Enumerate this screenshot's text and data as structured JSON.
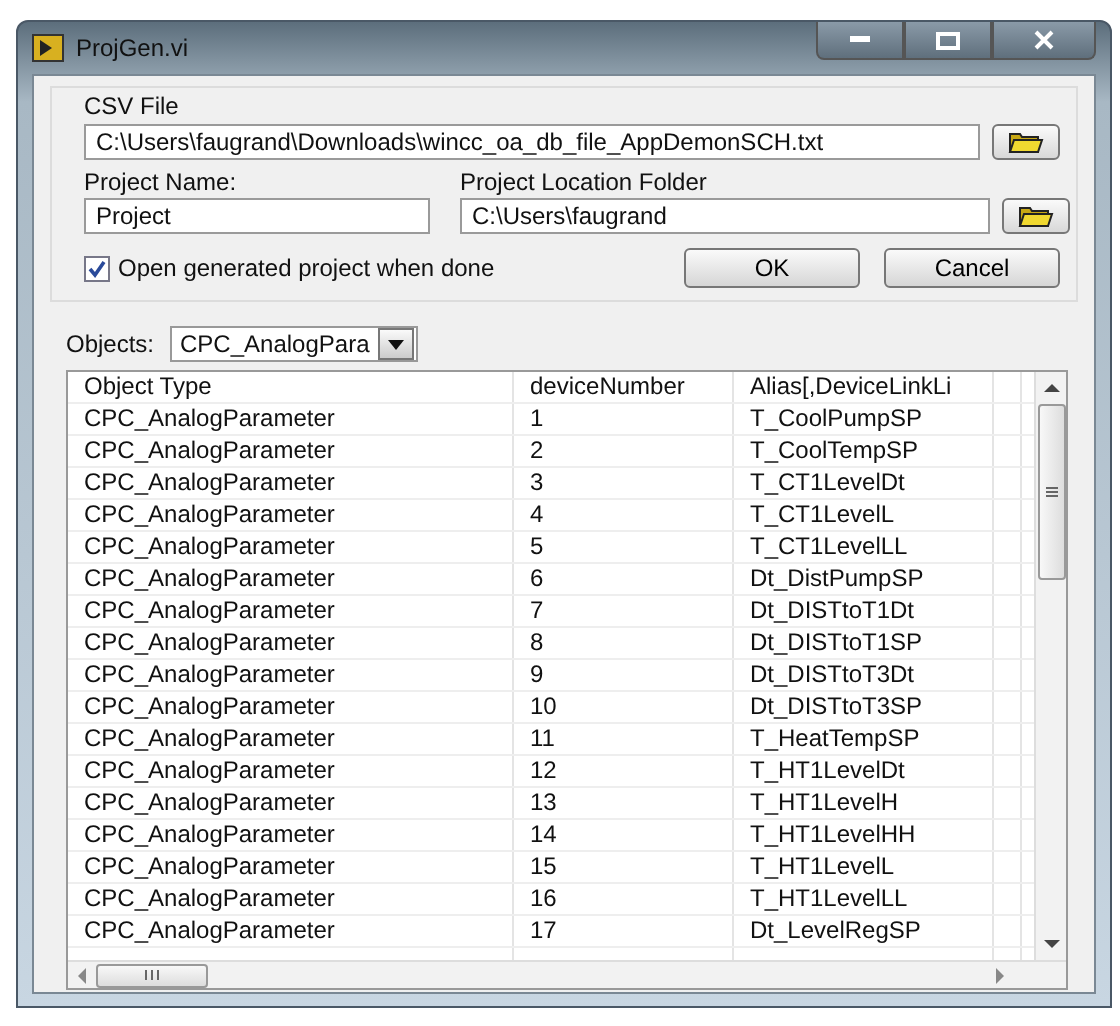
{
  "window": {
    "title": "ProjGen.vi"
  },
  "csv_file": {
    "label": "CSV File",
    "value": "C:\\Users\\faugrand\\Downloads\\wincc_oa_db_file_AppDemonSCH.txt"
  },
  "project_name": {
    "label": "Project Name:",
    "value": "Project"
  },
  "project_location": {
    "label": "Project Location Folder",
    "value": "C:\\Users\\faugrand"
  },
  "open_when_done": {
    "label": "Open generated project when done",
    "checked": true
  },
  "buttons": [
    "OK",
    "Cancel"
  ],
  "objects": {
    "label": "Objects:",
    "value": "CPC_AnalogPara"
  },
  "table": {
    "columns": [
      "Object Type",
      "deviceNumber",
      "Alias[,DeviceLinkLi"
    ],
    "rows": [
      [
        "CPC_AnalogParameter",
        "1",
        "T_CoolPumpSP"
      ],
      [
        "CPC_AnalogParameter",
        "2",
        "T_CoolTempSP"
      ],
      [
        "CPC_AnalogParameter",
        "3",
        "T_CT1LevelDt"
      ],
      [
        "CPC_AnalogParameter",
        "4",
        "T_CT1LevelL"
      ],
      [
        "CPC_AnalogParameter",
        "5",
        "T_CT1LevelLL"
      ],
      [
        "CPC_AnalogParameter",
        "6",
        "Dt_DistPumpSP"
      ],
      [
        "CPC_AnalogParameter",
        "7",
        "Dt_DISTtoT1Dt"
      ],
      [
        "CPC_AnalogParameter",
        "8",
        "Dt_DISTtoT1SP"
      ],
      [
        "CPC_AnalogParameter",
        "9",
        "Dt_DISTtoT3Dt"
      ],
      [
        "CPC_AnalogParameter",
        "10",
        "Dt_DISTtoT3SP"
      ],
      [
        "CPC_AnalogParameter",
        "11",
        "T_HeatTempSP"
      ],
      [
        "CPC_AnalogParameter",
        "12",
        "T_HT1LevelDt"
      ],
      [
        "CPC_AnalogParameter",
        "13",
        "T_HT1LevelH"
      ],
      [
        "CPC_AnalogParameter",
        "14",
        "T_HT1LevelHH"
      ],
      [
        "CPC_AnalogParameter",
        "15",
        "T_HT1LevelL"
      ],
      [
        "CPC_AnalogParameter",
        "16",
        "T_HT1LevelLL"
      ],
      [
        "CPC_AnalogParameter",
        "17",
        "Dt_LevelRegSP"
      ]
    ]
  }
}
